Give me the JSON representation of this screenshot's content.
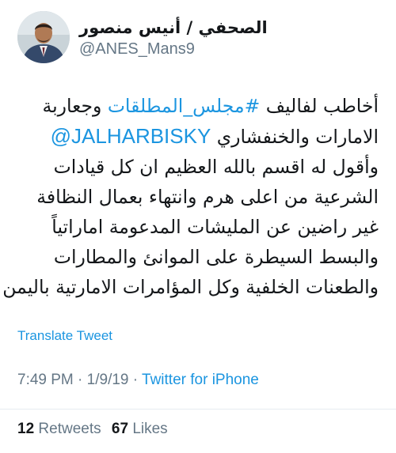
{
  "author": {
    "display_name": "الصحفي / أنيس منصور",
    "handle": "@ANES_Mans9"
  },
  "tweet": {
    "line1_text": "أخاطب لفاليف ",
    "hashtag": "#مجلس_المطلقات",
    "line1_end": " وجعاربة",
    "line2_text": "الامارات والخنفشاري ",
    "mention": "@JALHARBISKY",
    "line3": "وأقول له اقسم بالله العظيم ان كل قيادات",
    "line4": "الشرعية من اعلى هرم وانتهاء بعمال النظافة",
    "line5": "غير راضين عن المليشات المدعومة اماراتياً",
    "line6": "والبسط السيطرة على الموانئ والمطارات",
    "line7": "والطعنات الخلفية وكل المؤامرات الامارتية باليمن"
  },
  "translate_label": "Translate Tweet",
  "meta": {
    "time": "7:49 PM",
    "separator": " · ",
    "date": "1/9/19",
    "separator2": " · ",
    "source": "Twitter for iPhone"
  },
  "stats": {
    "retweets_count": "12",
    "retweets_label": "Retweets",
    "likes_count": "67",
    "likes_label": "Likes"
  },
  "colors": {
    "link": "#1b95e0",
    "secondary_text": "#657786",
    "primary_text": "#14171a",
    "divider": "#e6ecf0"
  }
}
